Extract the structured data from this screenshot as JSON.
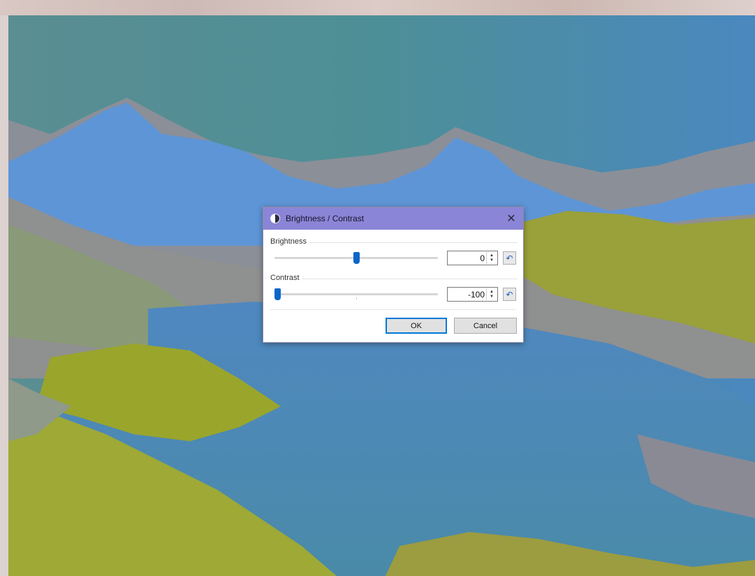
{
  "dialog": {
    "title": "Brightness / Contrast",
    "close_symbol": "✕",
    "brightness": {
      "label": "Brightness",
      "value": "0",
      "slider_fraction": 0.5,
      "reset_symbol": "↶"
    },
    "contrast": {
      "label": "Contrast",
      "value": "-100",
      "slider_fraction": 0.0,
      "reset_symbol": "↶"
    },
    "ok_label": "OK",
    "cancel_label": "Cancel"
  },
  "icons": {
    "title_icon": "brightness-contrast-icon",
    "close_icon": "close-icon",
    "reset_icon": "reset-icon",
    "spin_up_icon": "chevron-up-icon",
    "spin_down_icon": "chevron-down-icon"
  },
  "colors": {
    "titlebar": "#8a85d6",
    "slider_accent": "#0a66c8",
    "default_button_border": "#0078d7"
  }
}
